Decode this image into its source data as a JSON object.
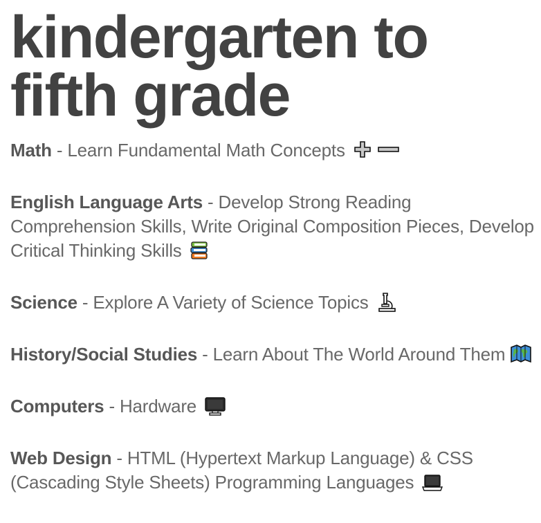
{
  "title": {
    "line1": "kindergarten to",
    "line2": "fifth grade"
  },
  "subjects": [
    {
      "name": "Math",
      "separator": " - ",
      "description": "Learn Fundamental Math Concepts",
      "icon": "plus-minus-icon"
    },
    {
      "name": "English Language Arts",
      "separator": " - ",
      "description": "Develop Strong Reading Comprehension Skills, Write Original Composition Pieces, Develop Critical Thinking Skills",
      "icon": "books-icon"
    },
    {
      "name": "Science",
      "separator": " - ",
      "description": "Explore A Variety of Science Topics",
      "icon": "microscope-icon"
    },
    {
      "name": "History/Social Studies",
      "separator": " - ",
      "description": "Learn About The World Around Them",
      "icon": "world-map-icon"
    },
    {
      "name": "Computers",
      "separator": " - ",
      "description": "Hardware",
      "icon": "desktop-computer-icon"
    },
    {
      "name": "Web Design",
      "separator": " - ",
      "description": "HTML (Hypertext Markup Language) & CSS (Cascading Style Sheets) Programming Languages",
      "icon": "laptop-icon"
    }
  ],
  "colors": {
    "title": "#424242",
    "subject_name": "#575757",
    "body_text": "#686868"
  }
}
